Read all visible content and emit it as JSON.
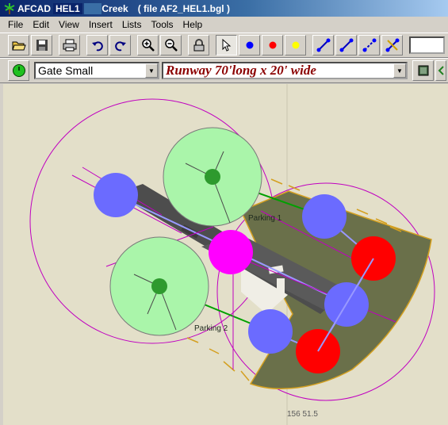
{
  "window": {
    "app_name": "AFCAD",
    "title_part1": "HEL1",
    "title_part2": "Creek",
    "title_file": "( file AF2_HEL1.bgl )"
  },
  "menu": [
    "File",
    "Edit",
    "View",
    "Insert",
    "Lists",
    "Tools",
    "Help"
  ],
  "toolbar": {
    "buttons": [
      "open-folder",
      "save",
      "print",
      "undo",
      "redo",
      "zoom-in",
      "zoom-out",
      "lock",
      "select-pointer",
      "blue-node",
      "red-node",
      "yellow-node",
      "link-blue",
      "link-blue-alt",
      "link-dashed",
      "link-crossing"
    ]
  },
  "toolbar2": {
    "parking_type": "Gate Small",
    "runway_desc": "Runway 70'long x 20' wide"
  },
  "map": {
    "parking_labels": [
      "Parking 1",
      "Parking 2"
    ],
    "coordinate": "156 51.5",
    "colors": {
      "background": "#e3dfc9",
      "apron": "#6a704a",
      "parking_fill": "#aaf5aa",
      "parking_center": "#2e9a2e",
      "node_blue": "#6b6bff",
      "node_red": "#ff0000",
      "heli_pad": "#ff00ff",
      "circle_outline": "#c000c0",
      "taxi_link": "#00a000",
      "taxi_blue": "#9999ff",
      "edge_line": "#d4a020"
    }
  }
}
